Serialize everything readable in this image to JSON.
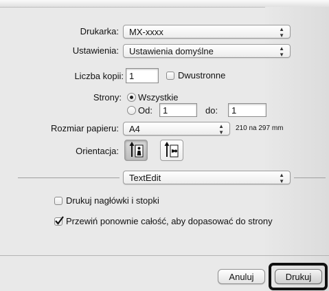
{
  "printer": {
    "label": "Drukarka:",
    "value": "MX-xxxx"
  },
  "presets": {
    "label": "Ustawienia:",
    "value": "Ustawienia domyślne"
  },
  "copies": {
    "label": "Liczba kopii:",
    "value": "1",
    "duplex_label": "Dwustronne",
    "duplex_checked": false
  },
  "pages": {
    "label": "Strony:",
    "all_label": "Wszystkie",
    "from_label": "Od:",
    "from_value": "1",
    "to_label": "do:",
    "to_value": "1",
    "selected": "all"
  },
  "paper": {
    "label": "Rozmiar papieru:",
    "value": "A4",
    "dimensions": "210 na 297 mm"
  },
  "orientation": {
    "label": "Orientacja:",
    "selected": "portrait",
    "icons": [
      "portrait-icon",
      "landscape-icon"
    ]
  },
  "section": {
    "value": "TextEdit"
  },
  "options": {
    "headers_label": "Drukuj nagłówki i stopki",
    "headers_checked": false,
    "rewrap_label": "Przewiń ponownie całość, aby dopasować do strony",
    "rewrap_checked": true
  },
  "buttons": {
    "cancel": "Anuluj",
    "print": "Drukuj"
  },
  "colors": {
    "highlight_border": "#111111",
    "dialog_bg": "#e9e9e9"
  }
}
